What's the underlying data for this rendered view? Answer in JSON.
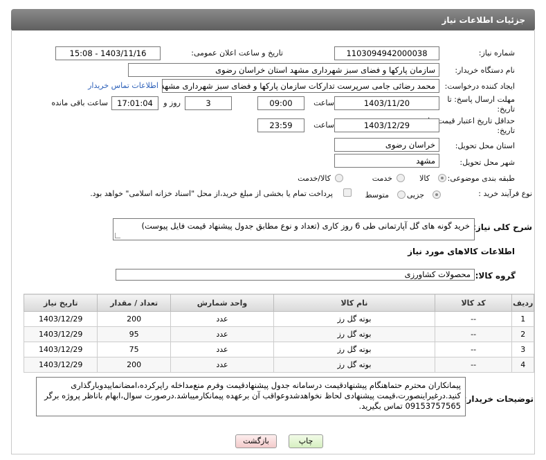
{
  "header": {
    "title": "جزئیات اطلاعات نیاز"
  },
  "form": {
    "need_number": {
      "label": "شماره نیاز:",
      "value": "1103094942000038"
    },
    "announce_datetime": {
      "label": "تاریخ و ساعت اعلان عمومی:",
      "value": "1403/11/16 - 15:08"
    },
    "buyer_org": {
      "label": "نام دستگاه خریدار:",
      "value": "سازمان پارکها و فضای سبز شهرداری مشهد استان خراسان رضوی"
    },
    "requester": {
      "label": "ایجاد کننده درخواست:",
      "value": "محمد رضائی جامی سرپرست تدارکات سازمان پارکها و فضای سبز شهرداری مشهد",
      "contact_link": "اطلاعات تماس خریدار"
    },
    "reply_deadline": {
      "label_line1": "مهلت ارسال پاسخ: تا",
      "label_line2": "تاریخ:",
      "date": "1403/11/20",
      "time_label": "ساعت",
      "time": "09:00",
      "days": "3",
      "days_label": "روز و",
      "remaining": "17:01:04",
      "remaining_label": "ساعت باقی مانده"
    },
    "price_validity": {
      "label_line1": "حداقل تاریخ اعتبار قیمت: تا",
      "label_line2": "تاریخ:",
      "date": "1403/12/29",
      "time_label": "ساعت",
      "time": "23:59"
    },
    "delivery_province": {
      "label": "استان محل تحویل:",
      "value": "خراسان رضوی"
    },
    "delivery_city": {
      "label": "شهر محل تحویل:",
      "value": "مشهد"
    },
    "category": {
      "label": "طبقه بندی موضوعی:",
      "options": [
        "کالا",
        "خدمت",
        "کالا/خدمت"
      ],
      "selected": "کالا"
    },
    "process_type": {
      "label": "نوع فرآیند خرید :",
      "options": [
        "جزیی",
        "متوسط"
      ],
      "selected": "جزیی",
      "payment_note": "پرداخت تمام یا بخشی از مبلغ خرید،از محل \"اسناد خزانه اسلامی\" خواهد بود."
    }
  },
  "description": {
    "label": "شرح کلی نیاز:",
    "value": "خرید گونه های گل آپارتمانی طی 6 روز کاری (تعداد و نوع مطابق جدول پیشنهاد قیمت فایل پیوست)"
  },
  "goods_section": {
    "title": "اطلاعات کالاهای مورد نیاز",
    "group_label": "گروه کالا:",
    "group_value": "محصولات کشاورزی"
  },
  "table": {
    "headers": [
      "ردیف",
      "کد کالا",
      "نام کالا",
      "واحد شمارش",
      "تعداد / مقدار",
      "تاریخ نیاز"
    ],
    "rows": [
      [
        "1",
        "--",
        "بوته گل رز",
        "عدد",
        "200",
        "1403/12/29"
      ],
      [
        "2",
        "--",
        "بوته گل رز",
        "عدد",
        "95",
        "1403/12/29"
      ],
      [
        "3",
        "--",
        "بوته گل رز",
        "عدد",
        "75",
        "1403/12/29"
      ],
      [
        "4",
        "--",
        "بوته گل رز",
        "عدد",
        "200",
        "1403/12/29"
      ]
    ]
  },
  "buyer_notes": {
    "label": "توضیحات خریدار:",
    "value": "پیمانکاران محترم حتماهنگام پیشنهادقیمت درسامانه جدول پیشنهادقیمت وفرم منع‌مداخله راپرکرده،امضانماییدوبارگذاری کنید.درغیراینصورت،قیمت پیشنهادی لحاظ نخواهدشدوعواقب آن برعهده پیمانکارمیباشد.درصورت سوال،ابهام باناظر پروژه برگر 09153757565 تماس بگیرید."
  },
  "buttons": {
    "print": "چاپ",
    "back": "بازگشت"
  }
}
